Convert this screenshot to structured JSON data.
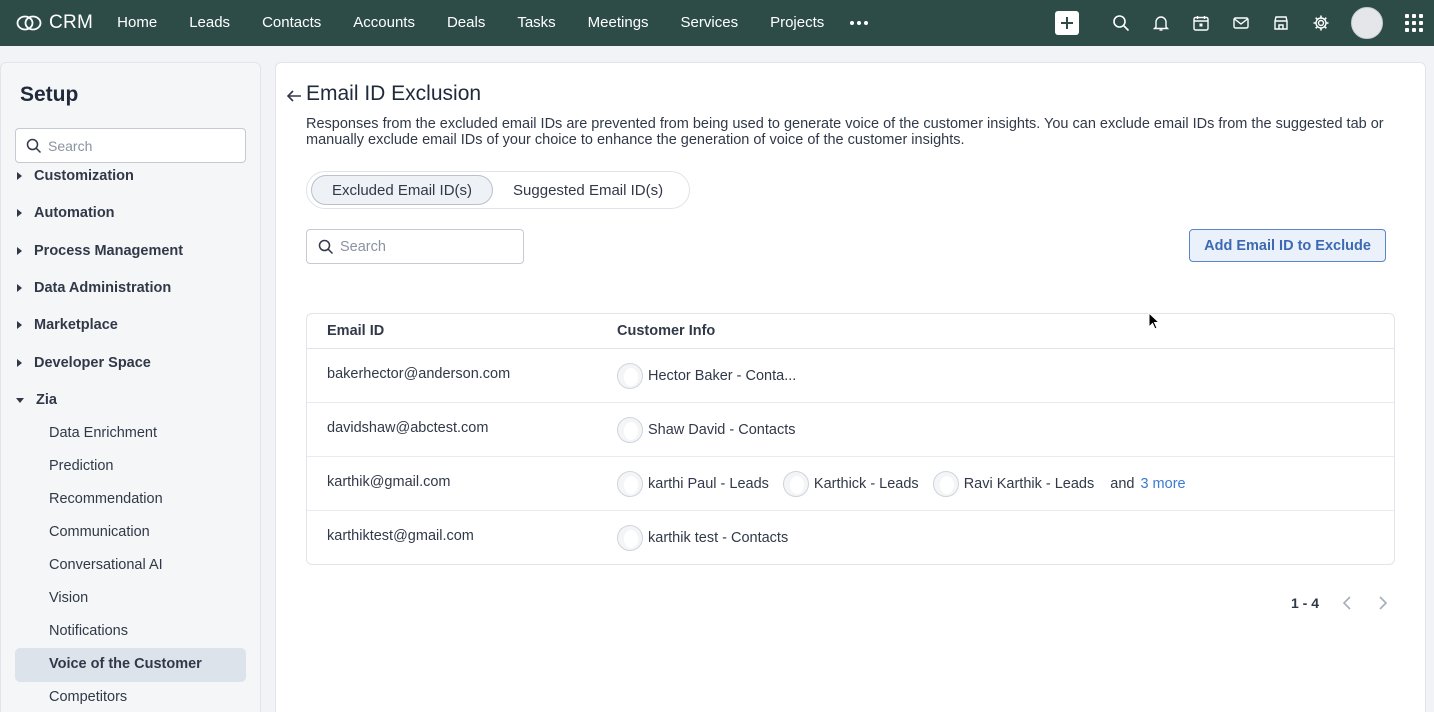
{
  "topnav": {
    "brand": "CRM",
    "items": [
      "Home",
      "Leads",
      "Contacts",
      "Accounts",
      "Deals",
      "Tasks",
      "Meetings",
      "Services",
      "Projects"
    ]
  },
  "sidebar": {
    "title": "Setup",
    "search_placeholder": "Search",
    "sections": [
      "Customization",
      "Automation",
      "Process Management",
      "Data Administration",
      "Marketplace",
      "Developer Space",
      "Zia"
    ],
    "zia_items": [
      "Data Enrichment",
      "Prediction",
      "Recommendation",
      "Communication",
      "Conversational AI",
      "Vision",
      "Notifications",
      "Voice of the Customer",
      "Competitors"
    ],
    "active_item": "Voice of the Customer"
  },
  "main": {
    "title": "Email ID Exclusion",
    "description": "Responses from the excluded email IDs are prevented from being used to generate voice of the customer insights. You can exclude email IDs from the suggested tab or manually exclude email IDs of your choice to enhance the generation of voice of the customer insights.",
    "tabs": [
      {
        "label": "Excluded Email ID(s)",
        "active": true
      },
      {
        "label": "Suggested Email ID(s)",
        "active": false
      }
    ],
    "search_placeholder": "Search",
    "add_button": "Add Email ID to Exclude",
    "table": {
      "headers": [
        "Email ID",
        "Customer Info"
      ],
      "rows": [
        {
          "email": "bakerhector@anderson.com",
          "customers": [
            "Hector Baker - Conta..."
          ]
        },
        {
          "email": "davidshaw@abctest.com",
          "customers": [
            "Shaw David - Contacts"
          ]
        },
        {
          "email": "karthik@gmail.com",
          "customers": [
            "karthi Paul - Leads",
            "Karthick - Leads",
            "Ravi Karthik - Leads"
          ],
          "and": "and",
          "more": "3 more"
        },
        {
          "email": "karthiktest@gmail.com",
          "customers": [
            "karthik test - Contacts"
          ]
        }
      ]
    },
    "pagination": "1 - 4"
  },
  "colors": {
    "topnav_bg": "#2d4c47",
    "accent": "#3c6ab2",
    "link": "#3c7ad1"
  }
}
